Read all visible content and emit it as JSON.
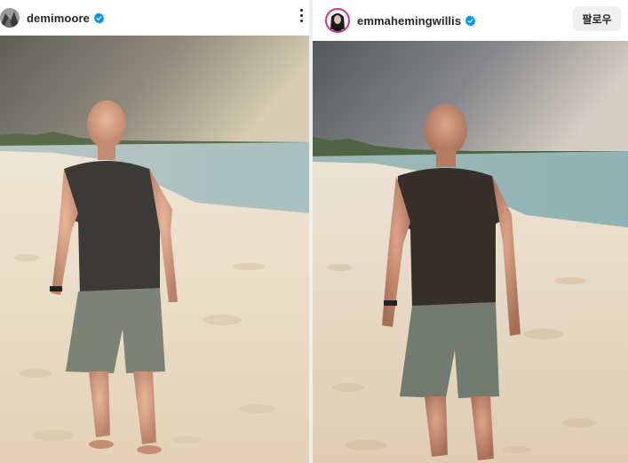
{
  "left_post": {
    "username": "demimoore",
    "verified": true,
    "avatar_icon": "profile-avatar",
    "more_icon": "more-options-vertical-icon",
    "photo_alt": "man-on-beach-photo"
  },
  "right_post": {
    "username": "emmahemingwillis",
    "verified": true,
    "avatar_icon": "profile-avatar-story-ring",
    "follow_label": "팔로우",
    "photo_alt": "man-on-beach-photo"
  },
  "colors": {
    "verified_blue": "#0095f6",
    "story_ring": "#d63384",
    "follow_bg": "#efefef",
    "text": "#262626"
  }
}
